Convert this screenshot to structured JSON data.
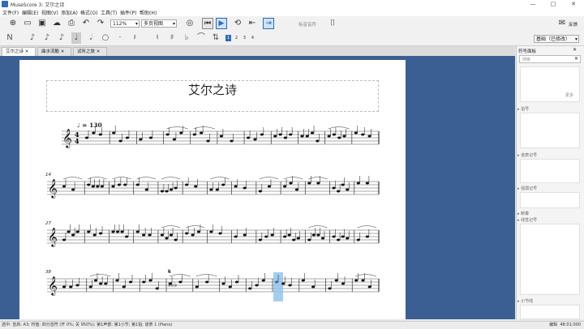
{
  "window": {
    "title": "MuseScore 3: 艾尔之诗"
  },
  "menu": [
    "文件(F)",
    "编辑(E)",
    "视图(V)",
    "添加(A)",
    "格式(O)",
    "工具(T)",
    "插件(P)",
    "帮助(H)"
  ],
  "toolbar": {
    "zoom": "112%",
    "view_mode": "多页视图",
    "playback_label": "标音音符",
    "feedback": "反馈"
  },
  "note_input": {
    "voices": [
      "1",
      "2",
      "3",
      "4"
    ],
    "workspace": "基础（已修改）"
  },
  "tabs": [
    "艾尔之诗",
    "曲水流觞",
    "试听之旅"
  ],
  "score": {
    "title": "艾尔之诗",
    "tempo": "= 130",
    "measure_numbers": [
      "14",
      "27",
      "38"
    ]
  },
  "palette": {
    "header": "符号面板",
    "search_placeholder": "搜索",
    "more": "更多",
    "sections": [
      "拍号",
      "谱表记号",
      "强弱记号",
      "断奏",
      "线性记号",
      "小节线"
    ]
  },
  "status": {
    "left": "选中: 音高: A3; 时值: 四分音符 (开 0%; 关 950%); 第1声部; 第1小节; 第1拍; 谱表 1 (Piano)",
    "mode": "编辑",
    "time": "48:01:000"
  },
  "colors": {
    "score_bg": "#3b5f93",
    "selection": "#8fc2ea",
    "active_blue": "#2d6cb8"
  }
}
